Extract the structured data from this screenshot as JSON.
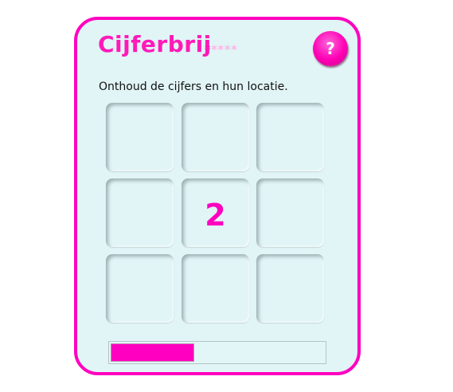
{
  "title": "Cijferbrij",
  "rating": {
    "filled": 1,
    "total": 5,
    "symbol": "*"
  },
  "help_label": "?",
  "instruction": "Onthoud de cijfers en hun locatie.",
  "cells": [
    "",
    "",
    "",
    "",
    "2",
    "",
    "",
    "",
    ""
  ],
  "progress_percent": 39,
  "colors": {
    "accent": "#ff00bf",
    "background": "#e1f4f6"
  }
}
